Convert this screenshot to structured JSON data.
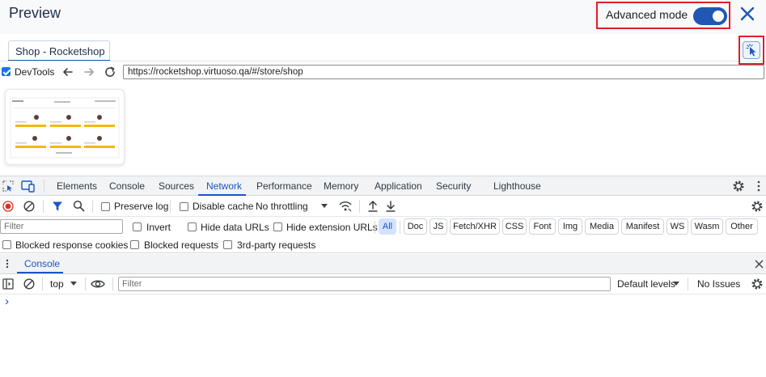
{
  "header": {
    "title": "Preview",
    "advanced_mode_label": "Advanced mode",
    "advanced_mode_on": true
  },
  "tabs": [
    {
      "label": "Shop - Rocketshop",
      "active": true
    }
  ],
  "browser": {
    "devtools_label": "DevTools",
    "devtools_checked": true,
    "url": "https://rocketshop.virtuoso.qa/#/store/shop"
  },
  "devtools": {
    "tabs": [
      "Elements",
      "Console",
      "Sources",
      "Network",
      "Performance",
      "Memory",
      "Application",
      "Security",
      "Lighthouse"
    ],
    "active_tab": "Network",
    "network_toolbar": {
      "preserve_log": "Preserve log",
      "disable_cache": "Disable cache",
      "throttling": "No throttling"
    },
    "filter": {
      "placeholder": "Filter",
      "invert": "Invert",
      "hide_data_urls": "Hide data URLs",
      "hide_extension_urls": "Hide extension URLs",
      "types": [
        "All",
        "Doc",
        "JS",
        "Fetch/XHR",
        "CSS",
        "Font",
        "Img",
        "Media",
        "Manifest",
        "WS",
        "Wasm",
        "Other"
      ],
      "active_type": "All"
    },
    "blocking": {
      "blocked_response_cookies": "Blocked response cookies",
      "blocked_requests": "Blocked requests",
      "third_party_requests": "3rd-party requests"
    },
    "drawer": {
      "tab_label": "Console",
      "context": "top",
      "filter_placeholder": "Filter",
      "levels": "Default levels",
      "issues": "No Issues",
      "prompt": "›"
    }
  },
  "colors": {
    "accent": "#1f57b5",
    "highlight_border": "#e01f26",
    "devtools_blue": "#1a56c6",
    "record_red": "#d93025"
  }
}
